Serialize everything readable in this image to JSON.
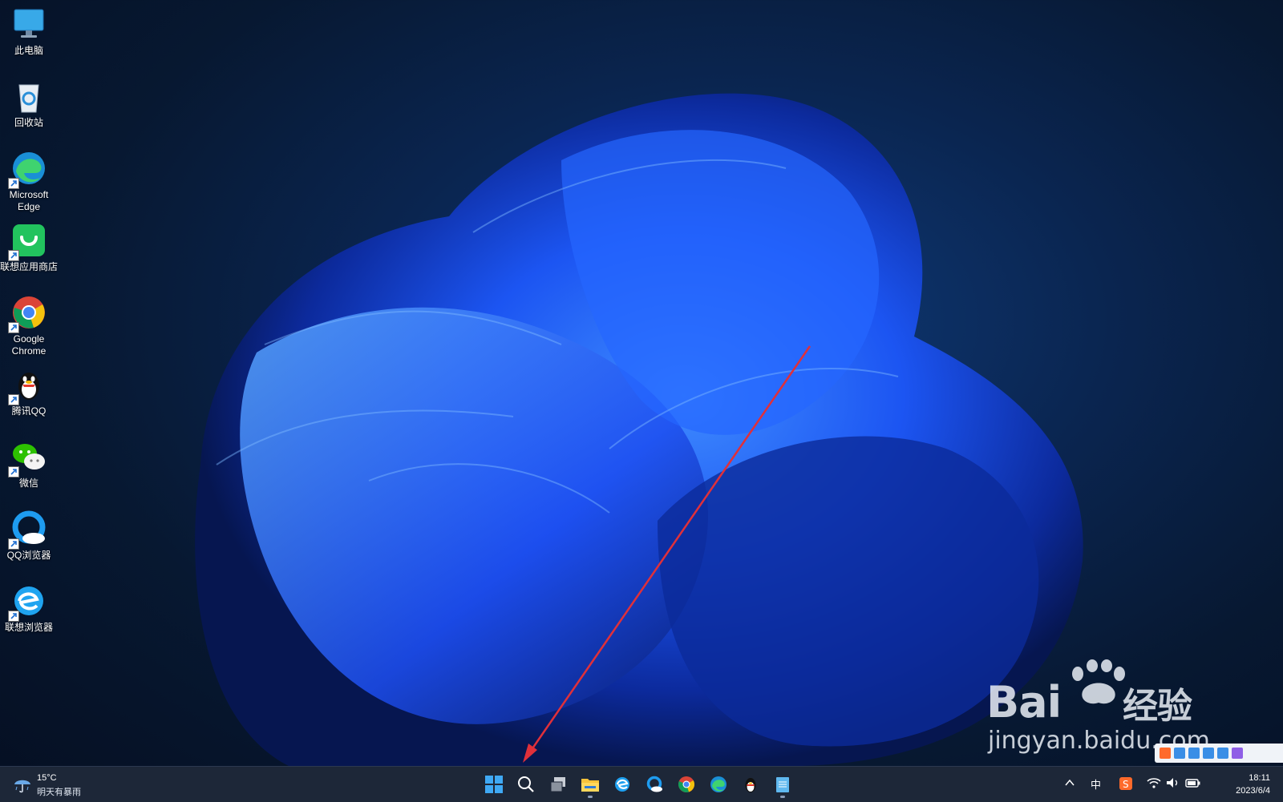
{
  "desktop": {
    "icons": [
      {
        "label": "此电脑",
        "icon": "monitor-icon"
      },
      {
        "label": "回收站",
        "icon": "recycle-bin-icon"
      },
      {
        "label": "Microsoft\nEdge",
        "icon": "edge-icon"
      },
      {
        "label": "联想应用商店",
        "icon": "lenovo-store-icon"
      },
      {
        "label": "Google\nChrome",
        "icon": "chrome-icon"
      },
      {
        "label": "腾讯QQ",
        "icon": "qq-icon"
      },
      {
        "label": "微信",
        "icon": "wechat-icon"
      },
      {
        "label": "QQ浏览器",
        "icon": "qq-browser-icon"
      },
      {
        "label": "联想浏览器",
        "icon": "lenovo-browser-icon"
      }
    ]
  },
  "taskbar": {
    "weather": {
      "temperature": "15°C",
      "forecast": "明天有暴雨"
    },
    "apps": [
      "start-icon",
      "search-icon",
      "task-view-icon",
      "file-explorer-icon",
      "ie-icon",
      "qq-browser-icon",
      "chrome-icon",
      "edge-icon",
      "qq-icon",
      "notepad-icon"
    ],
    "tray": {
      "ime": "中",
      "time": "18:11",
      "date": "2023/6/4"
    }
  },
  "watermark": {
    "brand": "Bai",
    "suffix": "经验",
    "url": "jingyan.baidu.com"
  },
  "colors": {
    "accent_red": "#e0303a",
    "taskbar_bg": "#1d2738",
    "wallpaper_blue": "#1f5cff"
  }
}
